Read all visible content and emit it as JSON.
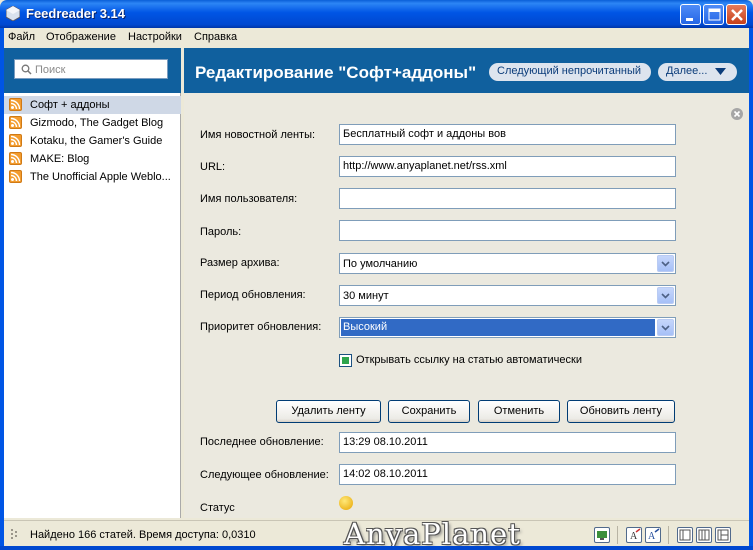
{
  "window": {
    "title": "Feedreader 3.14",
    "accent_color": "#0055e5",
    "header_color": "#10609e"
  },
  "menu": [
    "Файл",
    "Отображение",
    "Настройки",
    "Справка"
  ],
  "sidebar": {
    "search_placeholder": "Поиск",
    "feeds": [
      {
        "label": "Софт + аддоны",
        "selected": true,
        "icon": "rss-icon"
      },
      {
        "label": "Gizmodo, The Gadget Blog",
        "selected": false,
        "icon": "rss-icon"
      },
      {
        "label": "Kotaku, the Gamer's Guide",
        "selected": false,
        "icon": "rss-icon"
      },
      {
        "label": "MAKE: Blog",
        "selected": false,
        "icon": "rss-icon"
      },
      {
        "label": "The Unofficial Apple Weblo...",
        "selected": false,
        "icon": "rss-icon"
      }
    ]
  },
  "header": {
    "title": "Редактирование \"Софт+аддоны\"",
    "next_unread": "Следующий непрочитанный",
    "more": "Далее..."
  },
  "form": {
    "feed_name_label": "Имя новостной ленты:",
    "feed_name_value": "Бесплатный софт и аддоны вов",
    "url_label": "URL:",
    "url_value": "http://www.anyaplanet.net/rss.xml",
    "username_label": "Имя пользователя:",
    "username_value": "",
    "password_label": "Пароль:",
    "password_value": "",
    "archive_label": "Размер архива:",
    "archive_value": "По умолчанию",
    "period_label": "Период обновления:",
    "period_value": "30 минут",
    "priority_label": "Приоритет обновления:",
    "priority_value": "Высокий",
    "auto_open_label": "Открывать ссылку на статью автоматически",
    "auto_open_checked": true,
    "buttons": {
      "delete": "Удалить ленту",
      "save": "Сохранить",
      "cancel": "Отменить",
      "refresh": "Обновить ленту"
    },
    "last_update_label": "Последнее обновление:",
    "last_update_value": "13:29 08.10.2011",
    "next_update_label": "Следующее обновление:",
    "next_update_value": "14:02 08.10.2011",
    "status_label": "Статус"
  },
  "statusbar": {
    "text": "Найдено 166 статей. Время доступа: 0,0310",
    "watermark": "AnyaPlanet"
  }
}
